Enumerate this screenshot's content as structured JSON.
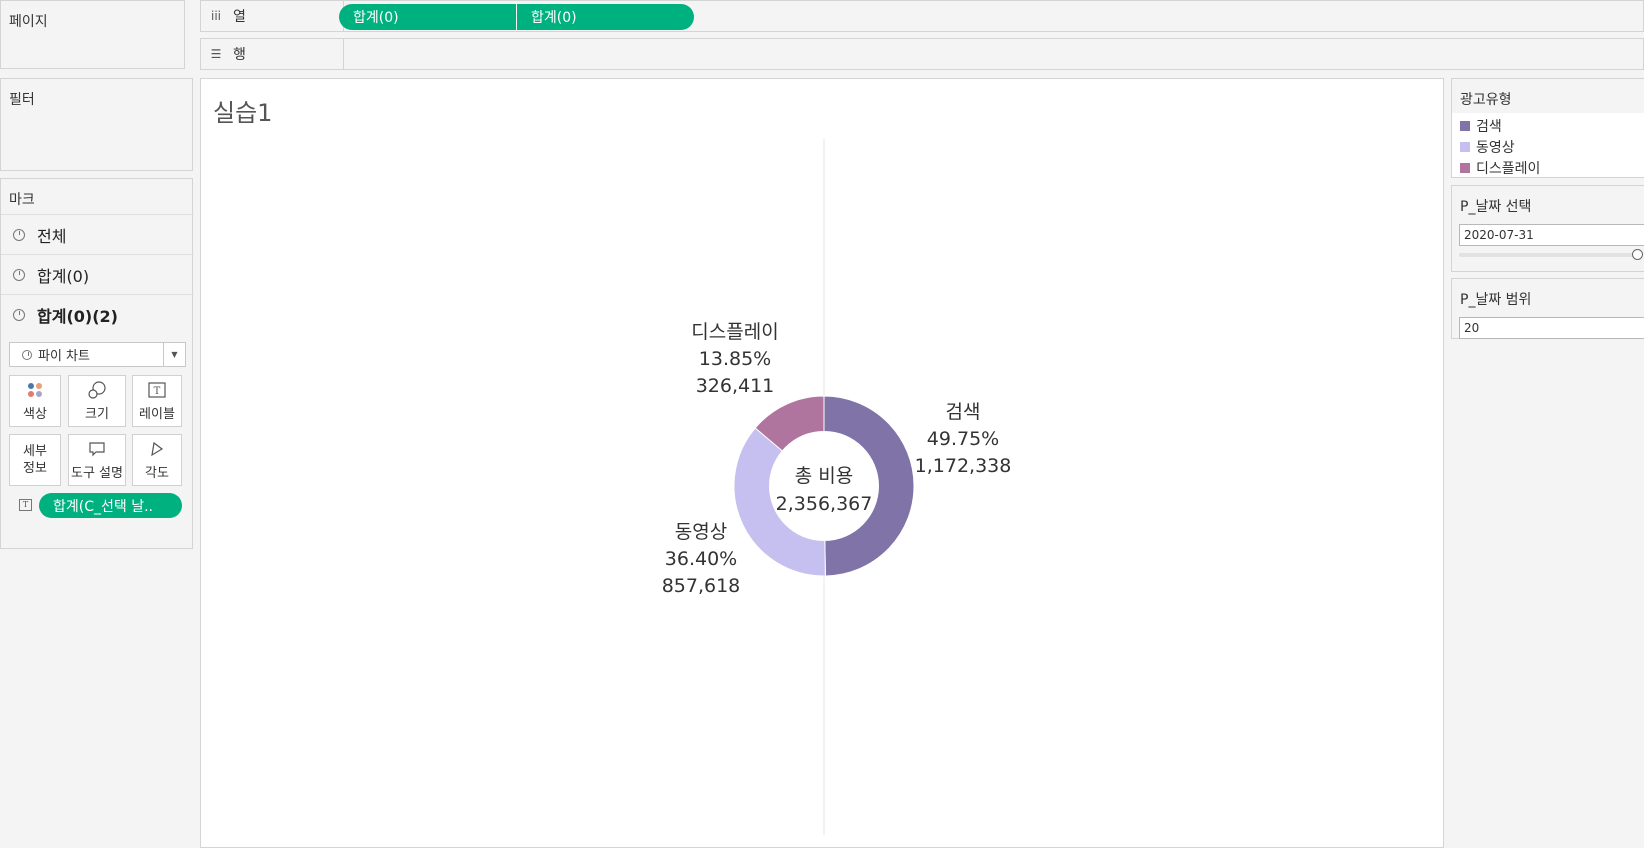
{
  "pages_card": {
    "title": "페이지"
  },
  "shelves": {
    "columns": {
      "label": "열",
      "icon": "columns-icon",
      "pills": [
        "합계(0)",
        "합계(0)"
      ]
    },
    "rows": {
      "label": "행",
      "icon": "rows-icon"
    }
  },
  "filters_card": {
    "title": "필터"
  },
  "marks_card": {
    "title": "마크",
    "layers": [
      {
        "label": "전체"
      },
      {
        "label": "합계(0)"
      },
      {
        "label": "합계(0)(2)"
      }
    ],
    "mark_type": "파이 차트",
    "buttons": [
      {
        "label": "색상",
        "icon": "color-icon"
      },
      {
        "label": "크기",
        "icon": "size-icon"
      },
      {
        "label": "레이블",
        "icon": "label-icon"
      },
      {
        "label": "세부\n정보",
        "icon": "detail-icon"
      },
      {
        "label": "도구 설명",
        "icon": "tooltip-icon"
      },
      {
        "label": "각도",
        "icon": "angle-icon"
      }
    ],
    "field_pill": "합계(C_선택 날.."
  },
  "view": {
    "sheet_title": "실습1",
    "center_label": "총 비용",
    "center_value": "2,356,367"
  },
  "chart_data": {
    "type": "pie",
    "title": "실습1",
    "center_text": [
      "총 비용",
      "2,356,367"
    ],
    "slices": [
      {
        "name": "검색",
        "value": 1172338,
        "percent": "49.75%",
        "value_label": "1,172,338",
        "color": "#7f73a8"
      },
      {
        "name": "동영상",
        "value": 857618,
        "percent": "36.40%",
        "value_label": "857,618",
        "color": "#c5c0ef"
      },
      {
        "name": "디스플레이",
        "value": 326411,
        "percent": "13.85%",
        "value_label": "326,411",
        "color": "#b0759f"
      }
    ],
    "total": 2356367
  },
  "legend": {
    "title": "광고유형",
    "items": [
      {
        "label": "검색",
        "color": "#7f73a8"
      },
      {
        "label": "동영상",
        "color": "#c5c0ef"
      },
      {
        "label": "디스플레이",
        "color": "#b0759f"
      }
    ]
  },
  "params": {
    "date_select": {
      "title": "P_날짜 선택",
      "value": "2020-07-31"
    },
    "date_range": {
      "title": "P_날짜 범위",
      "value": "20"
    }
  },
  "colors": {
    "accent_green": "#00b180"
  }
}
